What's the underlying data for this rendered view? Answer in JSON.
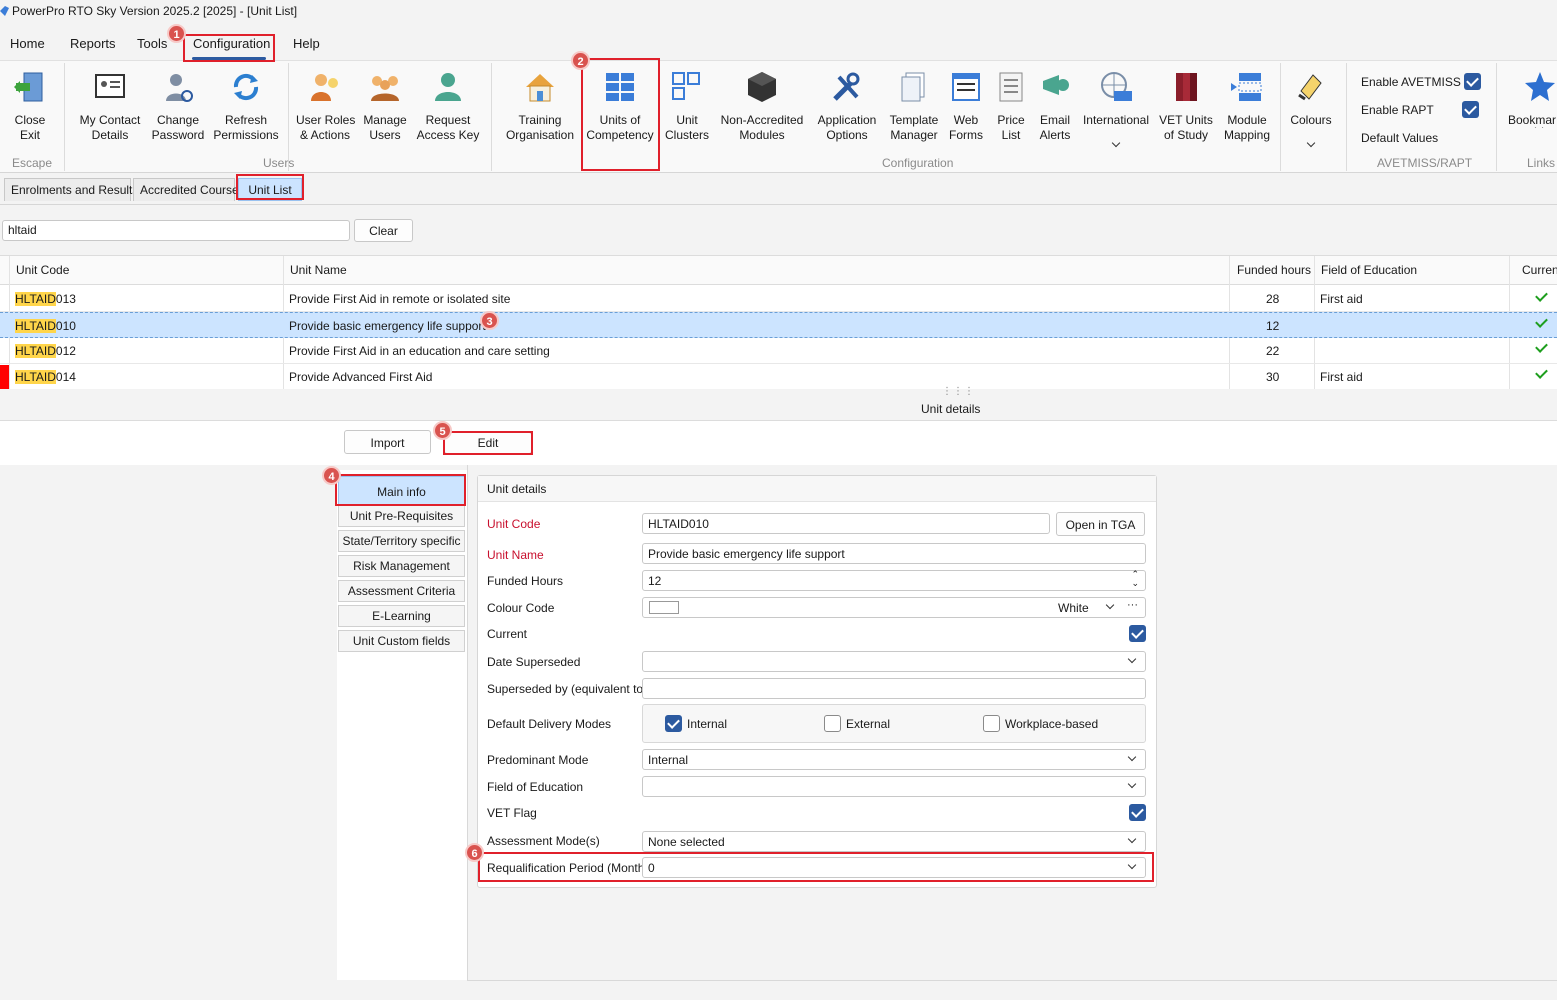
{
  "window": {
    "title": "PowerPro RTO Sky Version 2025.2 [2025] - [Unit List]"
  },
  "menu": [
    "Home",
    "Reports",
    "Tools",
    "Configuration",
    "Help"
  ],
  "ribbon": {
    "escape": {
      "group": "Escape",
      "buttons": [
        {
          "label": "Close\nExit",
          "icon": "close-exit-icon"
        }
      ]
    },
    "users": {
      "group": "Users",
      "buttons": [
        {
          "label": "My Contact\nDetails",
          "icon": "contact-card-icon"
        },
        {
          "label": "Change\nPassword",
          "icon": "change-password-icon"
        },
        {
          "label": "Refresh\nPermissions",
          "icon": "refresh-icon"
        },
        {
          "label": "User Roles\n& Actions",
          "icon": "user-roles-icon"
        },
        {
          "label": "Manage\nUsers",
          "icon": "manage-users-icon"
        },
        {
          "label": "Request\nAccess Key",
          "icon": "access-key-icon"
        }
      ]
    },
    "configuration": {
      "group": "Configuration",
      "buttons": [
        {
          "label": "Training\nOrganisation",
          "icon": "house-icon"
        },
        {
          "label": "Units of\nCompetency",
          "icon": "units-grid-icon"
        },
        {
          "label": "Unit\nClusters",
          "icon": "clusters-icon"
        },
        {
          "label": "Non-Accredited\nModules",
          "icon": "cube-icon"
        },
        {
          "label": "Application\nOptions",
          "icon": "tools-icon"
        },
        {
          "label": "Template\nManager",
          "icon": "template-icon"
        },
        {
          "label": "Web\nForms",
          "icon": "web-forms-icon"
        },
        {
          "label": "Price\nList",
          "icon": "price-list-icon"
        },
        {
          "label": "Email\nAlerts",
          "icon": "email-alerts-icon"
        },
        {
          "label": "International",
          "icon": "globe-icon"
        },
        {
          "label": "VET Units\nof Study",
          "icon": "books-icon"
        },
        {
          "label": "Module\nMapping",
          "icon": "module-mapping-icon"
        },
        {
          "label": "Colours",
          "icon": "paint-icon"
        }
      ]
    },
    "avetmiss": {
      "group": "AVETMISS/RAPT",
      "enable_avetmiss": "Enable AVETMISS",
      "enable_rapt": "Enable RAPT",
      "default_values": "Default Values"
    },
    "links": {
      "group": "Links",
      "bookmarks": "Bookmar"
    }
  },
  "tabs": [
    "Enrolments and Results",
    "Accredited Courses",
    "Unit List"
  ],
  "search": {
    "value": "hltaid",
    "clear_label": "Clear"
  },
  "grid": {
    "columns": [
      "Unit Code",
      "Unit Name",
      "Funded hours",
      "Field of Education",
      "Current"
    ],
    "rows": [
      {
        "code_hl": "HLTAID",
        "code_rest": "013",
        "name": "Provide First Aid in remote or isolated site",
        "hours": "28",
        "foe": "First aid",
        "current": true
      },
      {
        "code_hl": "HLTAID",
        "code_rest": "010",
        "name": "Provide basic emergency life support",
        "hours": "12",
        "foe": "",
        "current": true
      },
      {
        "code_hl": "HLTAID",
        "code_rest": "012",
        "name": "Provide First Aid in an education and care setting",
        "hours": "22",
        "foe": "",
        "current": true
      },
      {
        "code_hl": "HLTAID",
        "code_rest": "014",
        "name": "Provide Advanced First Aid",
        "hours": "30",
        "foe": "First aid",
        "current": true
      }
    ]
  },
  "unit_details_bar": "Unit details",
  "actions": {
    "import": "Import",
    "edit": "Edit"
  },
  "nav": [
    "Main info",
    "Unit Pre-Requisites",
    "State/Territory specific",
    "Risk Management",
    "Assessment Criteria",
    "E-Learning",
    "Unit Custom fields"
  ],
  "details": {
    "header": "Unit details",
    "unit_code_label": "Unit Code",
    "unit_code": "HLTAID010",
    "open_tga": "Open in TGA",
    "unit_name_label": "Unit Name",
    "unit_name": "Provide basic emergency life support",
    "funded_hours_label": "Funded Hours",
    "funded_hours": "12",
    "colour_code_label": "Colour Code",
    "colour_code": "White",
    "colour_more": "···",
    "current_label": "Current",
    "date_superseded_label": "Date Superseded",
    "superseded_by_label": "Superseded by (equivalent to)",
    "delivery_label": "Default Delivery Modes",
    "delivery_internal": "Internal",
    "delivery_external": "External",
    "delivery_workplace": "Workplace-based",
    "predominant_label": "Predominant Mode",
    "predominant": "Internal",
    "foe_label": "Field of Education",
    "vet_flag_label": "VET Flag",
    "assessment_label": "Assessment Mode(s)",
    "assessment": "None selected",
    "requal_label": "Requalification Period (Months)",
    "requal": "0"
  },
  "badges": [
    "1",
    "2",
    "3",
    "4",
    "5",
    "6"
  ],
  "colors": {
    "accent": "#2c5aa0",
    "selection": "#cce4ff",
    "highlight": "#ffd54a",
    "annotation": "#e0202b",
    "required": "#c8102e"
  }
}
